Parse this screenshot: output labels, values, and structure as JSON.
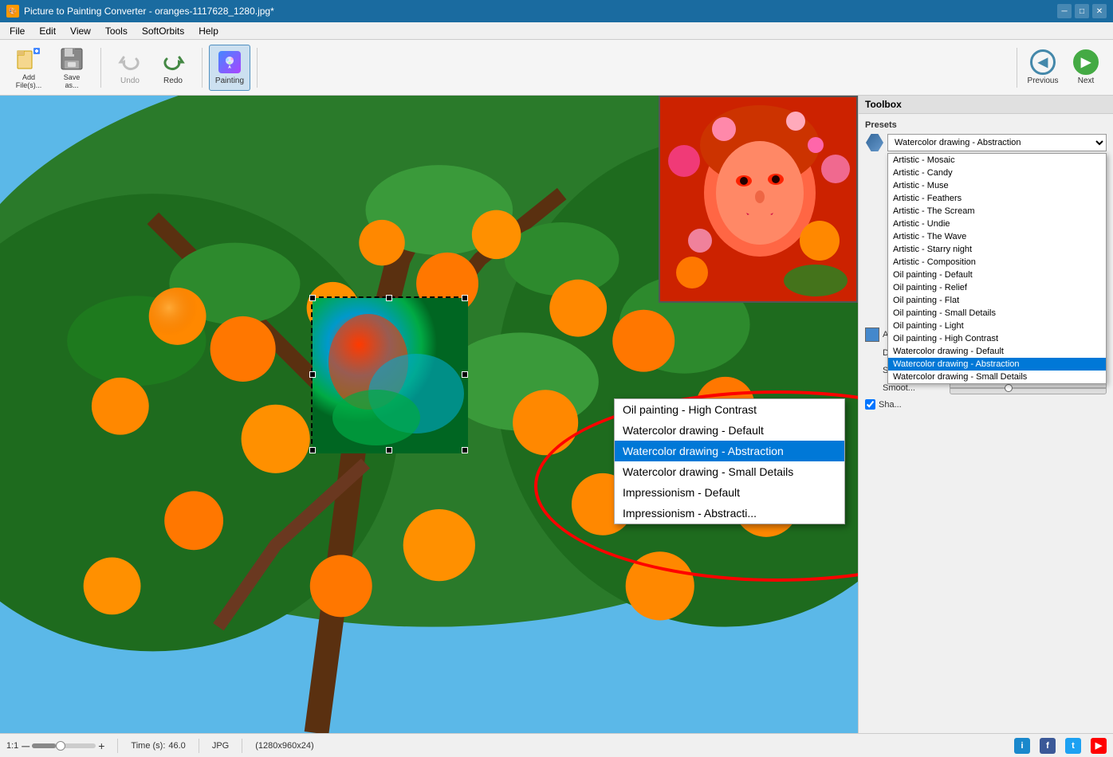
{
  "window": {
    "title": "Picture to Painting Converter - oranges-1117628_1280.jpg*",
    "icon": "🎨"
  },
  "titlebar": {
    "minimize": "─",
    "maximize": "□",
    "close": "✕"
  },
  "menu": {
    "items": [
      "File",
      "Edit",
      "View",
      "Tools",
      "SoftOrbits",
      "Help"
    ]
  },
  "toolbar": {
    "add_files_label": "Add\nFile(s)...",
    "save_as_label": "Save\nas...",
    "undo_label": "Undo",
    "redo_label": "Redo",
    "painting_label": "Painting",
    "previous_label": "Previous",
    "next_label": "Next"
  },
  "toolbox": {
    "title": "Toolbox",
    "presets_label": "Presets",
    "selected_preset": "Watercolor drawing - Abstraction",
    "abstract_label": "Abstra...",
    "detail_label": "Detail",
    "saturation_label": "Satura...",
    "smooth_label": "Smoot...",
    "share_shadow_label": "Sha...",
    "preset_items": [
      "Artistic - Mosaic",
      "Artistic - Candy",
      "Artistic - Muse",
      "Artistic - Feathers",
      "Artistic - The Scream",
      "Artistic - Undie",
      "Artistic - The Wave",
      "Artistic - Starry night",
      "Artistic - Composition",
      "Oil painting - Default",
      "Oil painting - Relief",
      "Oil painting - Flat",
      "Oil painting - Small Details",
      "Oil painting - Light",
      "Oil painting - High Contrast",
      "Watercolor drawing - Default",
      "Watercolor drawing - Abstraction",
      "Watercolor drawing - Small Details"
    ],
    "checkbox_share_label": "Sha..."
  },
  "big_dropdown": {
    "items": [
      {
        "label": "Oil painting - High Contrast",
        "selected": false
      },
      {
        "label": "Watercolor drawing - Default",
        "selected": false
      },
      {
        "label": "Watercolor drawing - Abstraction",
        "selected": true
      },
      {
        "label": "Watercolor drawing - Small Details",
        "selected": false
      },
      {
        "label": "Impressionism - Default",
        "selected": false
      },
      {
        "label": "Impressionism - Abstracti...",
        "selected": false
      }
    ]
  },
  "status": {
    "zoom": "1:1",
    "zoom_min": "─",
    "zoom_slider": "",
    "zoom_plus": "+",
    "time_label": "Time (s):",
    "time_value": "46.0",
    "format": "JPG",
    "dimensions": "(1280x960x24)"
  },
  "social": {
    "info_color": "#1a88cc",
    "fb_color": "#3b5998",
    "twitter_color": "#1da1f2",
    "youtube_color": "#ff0000"
  }
}
